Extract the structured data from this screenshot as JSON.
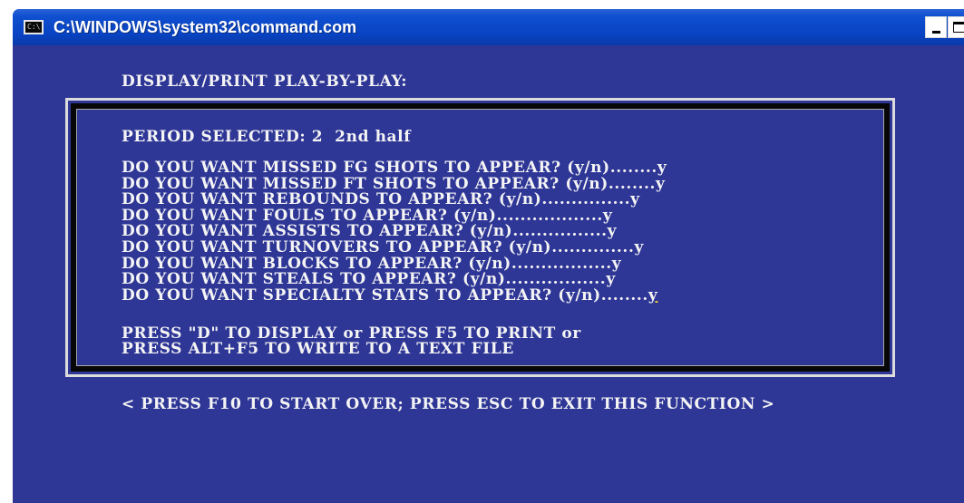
{
  "window": {
    "title": "C:\\WINDOWS\\system32\\command.com",
    "icon": "console-app-icon",
    "icon_text": "C:\\",
    "controls": {
      "minimize_icon": "minimize-icon",
      "maximize_icon": "maximize-icon",
      "close_icon": "close-icon"
    },
    "colors": {
      "titlebar": "#0843c2",
      "console_background": "#2e3696",
      "console_text": "#f4f4f4",
      "cursor": "#e2c330"
    }
  },
  "console": {
    "header": "DISPLAY/PRINT PLAY-BY-PLAY:",
    "period_label": "PERIOD SELECTED: 2  2nd half",
    "questions": [
      {
        "prompt": "DO YOU WANT MISSED FG SHOTS TO APPEAR? (y/n)........",
        "answer": "y"
      },
      {
        "prompt": "DO YOU WANT MISSED FT SHOTS TO APPEAR? (y/n)........",
        "answer": "y"
      },
      {
        "prompt": "DO YOU WANT REBOUNDS TO APPEAR? (y/n)...............",
        "answer": "y"
      },
      {
        "prompt": "DO YOU WANT FOULS TO APPEAR? (y/n)..................",
        "answer": "y"
      },
      {
        "prompt": "DO YOU WANT ASSISTS TO APPEAR? (y/n)................",
        "answer": "y"
      },
      {
        "prompt": "DO YOU WANT TURNOVERS TO APPEAR? (y/n)..............",
        "answer": "y"
      },
      {
        "prompt": "DO YOU WANT BLOCKS TO APPEAR? (y/n).................",
        "answer": "y"
      },
      {
        "prompt": "DO YOU WANT STEALS TO APPEAR? (y/n).................",
        "answer": "y"
      },
      {
        "prompt": "DO YOU WANT SPECIALTY STATS TO APPEAR? (y/n)........",
        "answer": "y"
      }
    ],
    "instruction_line1": "PRESS \"D\" TO DISPLAY or PRESS F5 TO PRINT or",
    "instruction_line2": "PRESS ALT+F5 TO WRITE TO A TEXT FILE",
    "footer": "< PRESS F10 TO START OVER; PRESS ESC TO EXIT THIS FUNCTION >"
  }
}
